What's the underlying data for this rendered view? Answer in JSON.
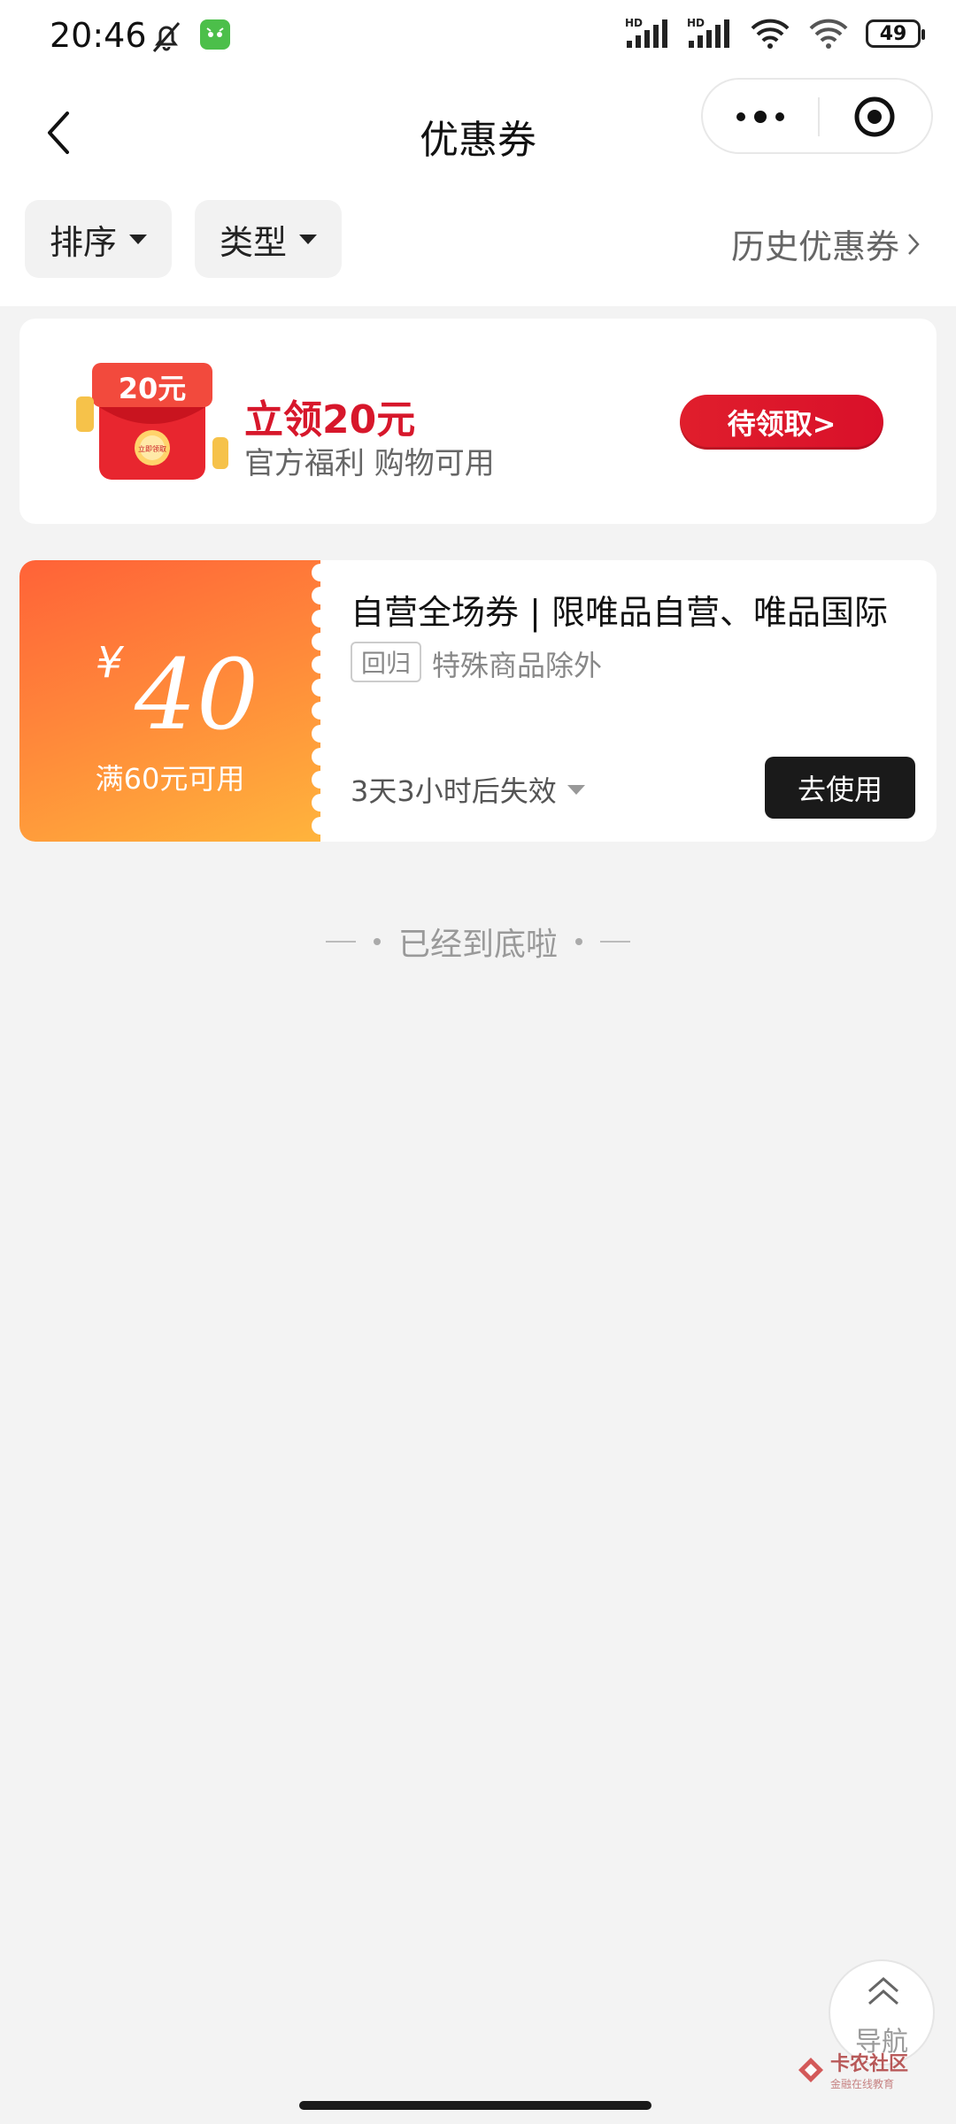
{
  "status_bar": {
    "time": "20:46",
    "icons": [
      "bell-off-icon",
      "app-notification-icon",
      "hd-signal-icon",
      "hd-signal-icon",
      "wifi-icon",
      "wifi-icon"
    ],
    "network_badge": "HD",
    "battery": "49"
  },
  "header": {
    "title": "优惠券",
    "back_icon": "chevron-left-icon",
    "more_icon": "more-dots-icon",
    "close_icon": "target-close-icon"
  },
  "filters": {
    "sort_label": "排序",
    "type_label": "类型",
    "history_label": "历史优惠券"
  },
  "promo": {
    "envelope_text": "20元",
    "envelope_badge": "立即领取",
    "title": "立领20元",
    "subtitle": "官方福利 购物可用",
    "button": "待领取>"
  },
  "coupon": {
    "currency": "¥",
    "amount": "40",
    "threshold": "满60元可用",
    "title": "自营全场券 | 限唯品自营、唯品国际",
    "tag": "回归",
    "description": "特殊商品除外",
    "expiry": "3天3小时后失效",
    "use_button": "去使用"
  },
  "end_text": "已经到底啦",
  "nav": {
    "label": "导航"
  },
  "watermark": {
    "text": "卡农社区",
    "sub": "金融在线教育"
  },
  "colors": {
    "accent_red": "#d7172b",
    "coupon_orange": "#ff7a3a",
    "dark_button": "#1a1a1a"
  }
}
